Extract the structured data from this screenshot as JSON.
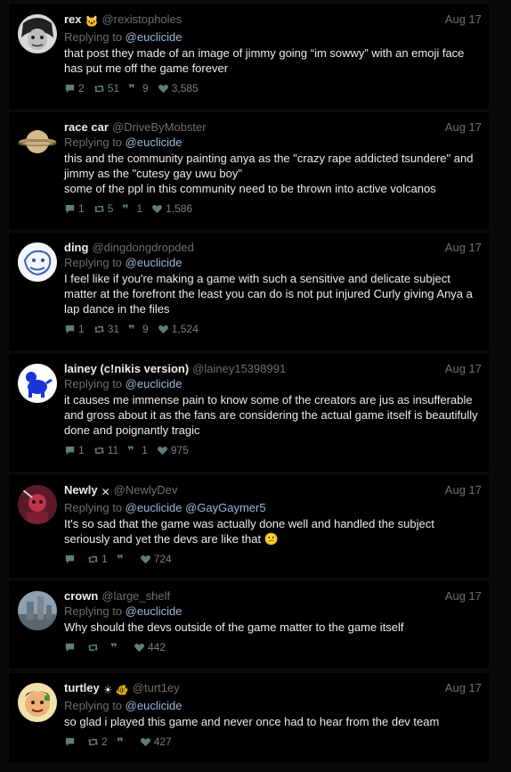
{
  "tweets": [
    {
      "name": "rex",
      "name_emoji": "🐱",
      "handle": "@rexistopholes",
      "date": "Aug 17",
      "replying_prefix": "Replying to",
      "replying_to": [
        "@euclicide"
      ],
      "text": "that post they made of an image of jimmy going “im sowwy” with an emoji face has put me off the game forever",
      "replies": "2",
      "retweets": "51",
      "quotes": "9",
      "likes": "3,585",
      "avatar": "bw-face-avatar"
    },
    {
      "name": "race car",
      "name_emoji": "",
      "handle": "@DriveByMobster",
      "date": "Aug 17",
      "replying_prefix": "Replying to",
      "replying_to": [
        "@euclicide"
      ],
      "text": "this and the community painting anya as the \"crazy rape addicted tsundere\" and jimmy as the \"cutesy gay uwu boy\"\nsome of the ppl in this community need to be thrown into active volcanos",
      "replies": "1",
      "retweets": "5",
      "quotes": "1",
      "likes": "1,586",
      "avatar": "saturn-avatar"
    },
    {
      "name": "ding",
      "name_emoji": "",
      "handle": "@dingdongdropded",
      "date": "Aug 17",
      "replying_prefix": "Replying to",
      "replying_to": [
        "@euclicide"
      ],
      "text": "I feel like if you're making a game with such a sensitive and delicate subject matter at the forefront the least you can do is not put injured Curly giving Anya a lap dance in the files",
      "replies": "1",
      "retweets": "31",
      "quotes": "9",
      "likes": "1,524",
      "avatar": "blue-sketch-avatar"
    },
    {
      "name": "lainey (c!nikis version)",
      "name_emoji": "",
      "handle": "@lainey15398991",
      "date": "Aug 17",
      "replying_prefix": "Replying to",
      "replying_to": [
        "@euclicide"
      ],
      "text": "it causes me immense pain to know some of the creators are jus as insufferable and gross about it as the fans are considering the actual game itself is beautifully done and poignantly tragic",
      "replies": "1",
      "retweets": "11",
      "quotes": "1",
      "likes": "975",
      "avatar": "blue-dog-avatar"
    },
    {
      "name": "Newly",
      "name_emoji": "✕",
      "handle": "@NewlyDev",
      "date": "Aug 17",
      "replying_prefix": "Replying to",
      "replying_to": [
        "@euclicide",
        "@GayGaymer5"
      ],
      "text": "It's so sad that the game was actually done well and handled the subject seriously and yet the devs are like that 😕",
      "replies": "",
      "retweets": "1",
      "quotes": "",
      "likes": "724",
      "avatar": "red-character-avatar"
    },
    {
      "name": "crown",
      "name_emoji": "",
      "handle": "@large_shelf",
      "date": "Aug 17",
      "replying_prefix": "Replying to",
      "replying_to": [
        "@euclicide"
      ],
      "text": "Why should the devs outside of the game matter to the game itself",
      "replies": "",
      "retweets": "",
      "quotes": "",
      "likes": "442",
      "avatar": "city-photo-avatar"
    },
    {
      "name": "turtley",
      "name_emoji": "☀ 🐠",
      "handle": "@turt1ey",
      "date": "Aug 17",
      "replying_prefix": "Replying to",
      "replying_to": [
        "@euclicide"
      ],
      "text": "so glad i played this game and never once had to hear from the dev team",
      "replies": "",
      "retweets": "2",
      "quotes": "",
      "likes": "427",
      "avatar": "cartoon-face-avatar"
    }
  ],
  "colors": {
    "background": "#0a0a0a",
    "card": "#000000",
    "text": "#ececec",
    "muted": "#6e6e6e",
    "mention": "#9ab8d8"
  }
}
